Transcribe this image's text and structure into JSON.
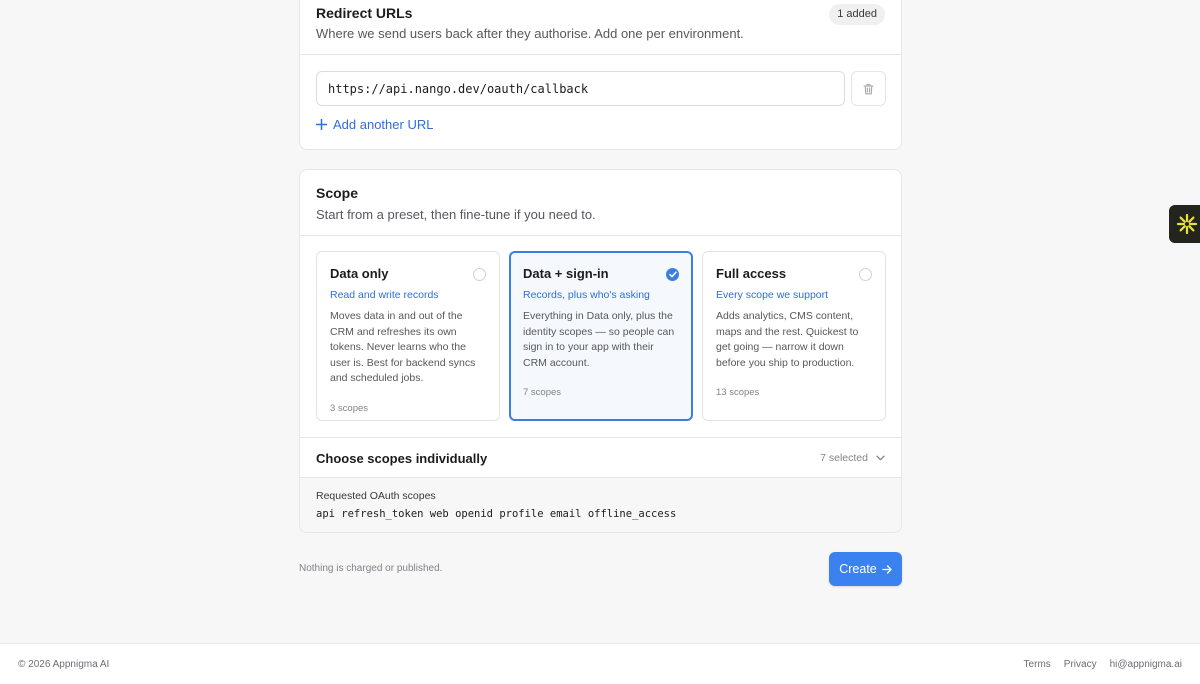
{
  "redirect": {
    "title": "Redirect URLs",
    "subtitle": "Where we send users back after they authorise. Add one per environment.",
    "badge": "1 added",
    "url_value": "https://api.nango.dev/oauth/callback",
    "add_label": "Add another URL"
  },
  "scope": {
    "title": "Scope",
    "subtitle": "Start from a preset, then fine-tune if you need to.",
    "presets": [
      {
        "title": "Data only",
        "tagline": "Read and write records",
        "description": "Moves data in and out of the CRM and refreshes its own tokens. Never learns who the user is. Best for backend syncs and scheduled jobs.",
        "count": "3 scopes",
        "selected": false
      },
      {
        "title": "Data + sign-in",
        "tagline": "Records, plus who's asking",
        "description": "Everything in Data only, plus the identity scopes — so people can sign in to your app with their CRM account.",
        "count": "7 scopes",
        "selected": true
      },
      {
        "title": "Full access",
        "tagline": "Every scope we support",
        "description": "Adds analytics, CMS content, maps and the rest. Quickest to get going — narrow it down before you ship to production.",
        "count": "13 scopes",
        "selected": false
      }
    ],
    "choose_label": "Choose scopes individually",
    "choose_count": "7 selected",
    "requested_label": "Requested OAuth scopes",
    "requested_value": "api refresh_token web openid profile email offline_access"
  },
  "actions": {
    "note": "Nothing is charged or published.",
    "create_label": "Create"
  },
  "footer": {
    "copyright": "© 2026 Appnigma AI",
    "links": [
      "Terms",
      "Privacy",
      "hi@appnigma.ai"
    ]
  },
  "colors": {
    "accent": "#3b82f0",
    "link": "#2f6fd8",
    "widget_bg": "#24241f",
    "widget_icon": "#e8e337"
  }
}
